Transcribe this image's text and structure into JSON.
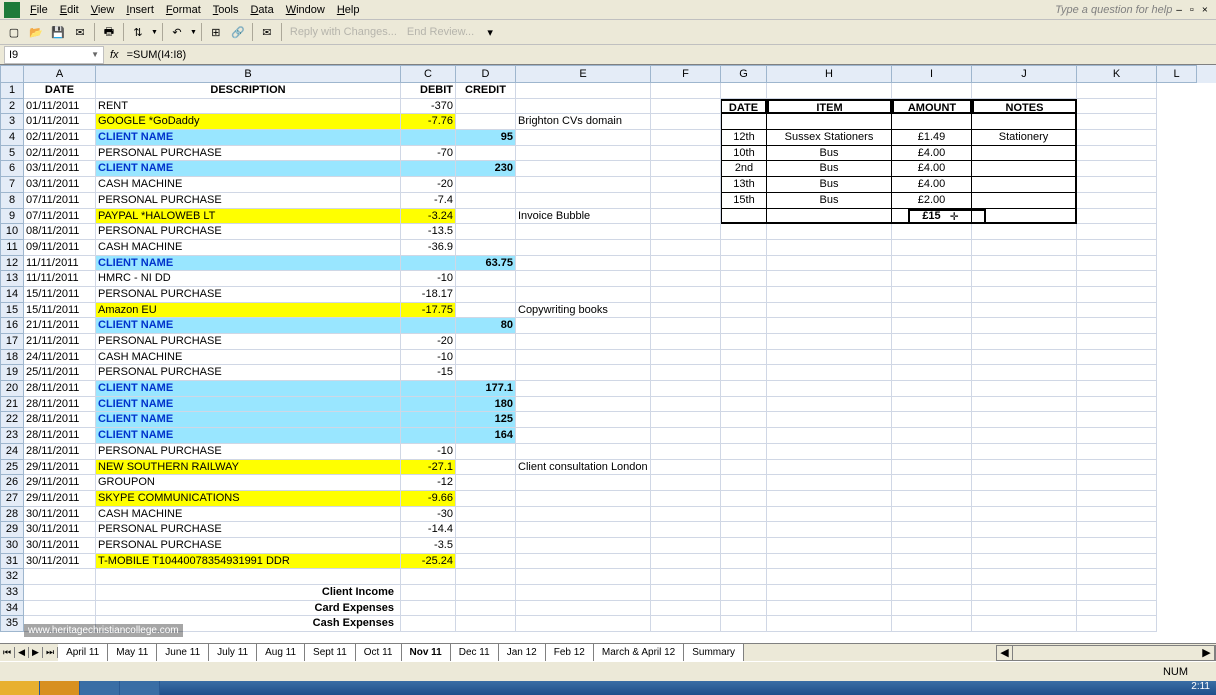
{
  "menu": {
    "file": "File",
    "edit": "Edit",
    "view": "View",
    "insert": "Insert",
    "format": "Format",
    "tools": "Tools",
    "data": "Data",
    "window": "Window",
    "help": "Help",
    "help_q": "Type a question for help"
  },
  "toolbar": {
    "reply": "Reply with Changes...",
    "endreview": "End Review..."
  },
  "namebox": "I9",
  "formula": "=SUM(I4:I8)",
  "columns": [
    "A",
    "B",
    "C",
    "D",
    "E",
    "F",
    "G",
    "H",
    "I",
    "J",
    "K",
    "L"
  ],
  "headers": {
    "date": "DATE",
    "desc": "DESCRIPTION",
    "debit": "DEBIT",
    "credit": "CREDIT"
  },
  "rows": [
    {
      "n": 2,
      "date": "01/11/2011",
      "desc": "RENT",
      "debit": "-370",
      "hl": ""
    },
    {
      "n": 3,
      "date": "01/11/2011",
      "desc": "GOOGLE *GoDaddy",
      "debit": "-7.76",
      "hl": "y",
      "note": "Brighton CVs domain"
    },
    {
      "n": 4,
      "date": "02/11/2011",
      "desc": "CLIENT NAME",
      "credit": "95",
      "hl": "c"
    },
    {
      "n": 5,
      "date": "02/11/2011",
      "desc": "PERSONAL PURCHASE",
      "debit": "-70"
    },
    {
      "n": 6,
      "date": "03/11/2011",
      "desc": "CLIENT NAME",
      "credit": "230",
      "hl": "c"
    },
    {
      "n": 7,
      "date": "03/11/2011",
      "desc": "CASH MACHINE",
      "debit": "-20"
    },
    {
      "n": 8,
      "date": "07/11/2011",
      "desc": "PERSONAL PURCHASE",
      "debit": "-7.4"
    },
    {
      "n": 9,
      "date": "07/11/2011",
      "desc": "PAYPAL *HALOWEB LT",
      "debit": "-3.24",
      "hl": "y",
      "note": "Invoice Bubble"
    },
    {
      "n": 10,
      "date": "08/11/2011",
      "desc": "PERSONAL PURCHASE",
      "debit": "-13.5"
    },
    {
      "n": 11,
      "date": "09/11/2011",
      "desc": "CASH MACHINE",
      "debit": "-36.9"
    },
    {
      "n": 12,
      "date": "11/11/2011",
      "desc": "CLIENT NAME",
      "credit": "63.75",
      "hl": "c"
    },
    {
      "n": 13,
      "date": "11/11/2011",
      "desc": "HMRC - NI DD",
      "debit": "-10"
    },
    {
      "n": 14,
      "date": "15/11/2011",
      "desc": "PERSONAL PURCHASE",
      "debit": "-18.17"
    },
    {
      "n": 15,
      "date": "15/11/2011",
      "desc": "Amazon EU",
      "debit": "-17.75",
      "hl": "y",
      "note": "Copywriting books"
    },
    {
      "n": 16,
      "date": "21/11/2011",
      "desc": "CLIENT NAME",
      "credit": "80",
      "hl": "c"
    },
    {
      "n": 17,
      "date": "21/11/2011",
      "desc": "PERSONAL PURCHASE",
      "debit": "-20"
    },
    {
      "n": 18,
      "date": "24/11/2011",
      "desc": "CASH MACHINE",
      "debit": "-10"
    },
    {
      "n": 19,
      "date": "25/11/2011",
      "desc": "PERSONAL PURCHASE",
      "debit": "-15"
    },
    {
      "n": 20,
      "date": "28/11/2011",
      "desc": "CLIENT NAME",
      "credit": "177.1",
      "hl": "c"
    },
    {
      "n": 21,
      "date": "28/11/2011",
      "desc": "CLIENT NAME",
      "credit": "180",
      "hl": "c"
    },
    {
      "n": 22,
      "date": "28/11/2011",
      "desc": "CLIENT NAME",
      "credit": "125",
      "hl": "c"
    },
    {
      "n": 23,
      "date": "28/11/2011",
      "desc": "CLIENT NAME",
      "credit": "164",
      "hl": "c"
    },
    {
      "n": 24,
      "date": "28/11/2011",
      "desc": "PERSONAL PURCHASE",
      "debit": "-10"
    },
    {
      "n": 25,
      "date": "29/11/2011",
      "desc": "NEW SOUTHERN RAILWAY",
      "debit": "-27.1",
      "hl": "y",
      "note": "Client consultation London"
    },
    {
      "n": 26,
      "date": "29/11/2011",
      "desc": "GROUPON",
      "debit": "-12"
    },
    {
      "n": 27,
      "date": "29/11/2011",
      "desc": "SKYPE COMMUNICATIONS",
      "debit": "-9.66",
      "hl": "y"
    },
    {
      "n": 28,
      "date": "30/11/2011",
      "desc": "CASH MACHINE",
      "debit": "-30"
    },
    {
      "n": 29,
      "date": "30/11/2011",
      "desc": "PERSONAL PURCHASE",
      "debit": "-14.4"
    },
    {
      "n": 30,
      "date": "30/11/2011",
      "desc": "PERSONAL PURCHASE",
      "debit": "-3.5"
    },
    {
      "n": 31,
      "date": "30/11/2011",
      "desc": "T-MOBILE          T10440078354931991 DDR",
      "debit": "-25.24",
      "hl": "y"
    }
  ],
  "summary": {
    "income": "Client Income",
    "card": "Card Expenses",
    "cash": "Cash Expenses"
  },
  "sidetable": {
    "hdr": {
      "date": "DATE",
      "item": "ITEM",
      "amount": "AMOUNT",
      "notes": "NOTES"
    },
    "rows": [
      {
        "date": "12th",
        "item": "Sussex Stationers",
        "amount": "£1.49",
        "notes": "Stationery"
      },
      {
        "date": "10th",
        "item": "Bus",
        "amount": "£4.00",
        "notes": ""
      },
      {
        "date": "2nd",
        "item": "Bus",
        "amount": "£4.00",
        "notes": ""
      },
      {
        "date": "13th",
        "item": "Bus",
        "amount": "£4.00",
        "notes": ""
      },
      {
        "date": "15th",
        "item": "Bus",
        "amount": "£2.00",
        "notes": ""
      }
    ],
    "total": "£15"
  },
  "tabs": [
    "April 11",
    "May 11",
    "June 11",
    "July 11",
    "Aug 11",
    "Sept 11",
    "Oct 11",
    "Nov 11",
    "Dec 11",
    "Jan 12",
    "Feb 12",
    "March & April 12",
    "Summary"
  ],
  "active_tab": "Nov 11",
  "status": {
    "num": "NUM"
  },
  "watermark": "www.heritagechristiancollege.com",
  "clock": "2:11"
}
